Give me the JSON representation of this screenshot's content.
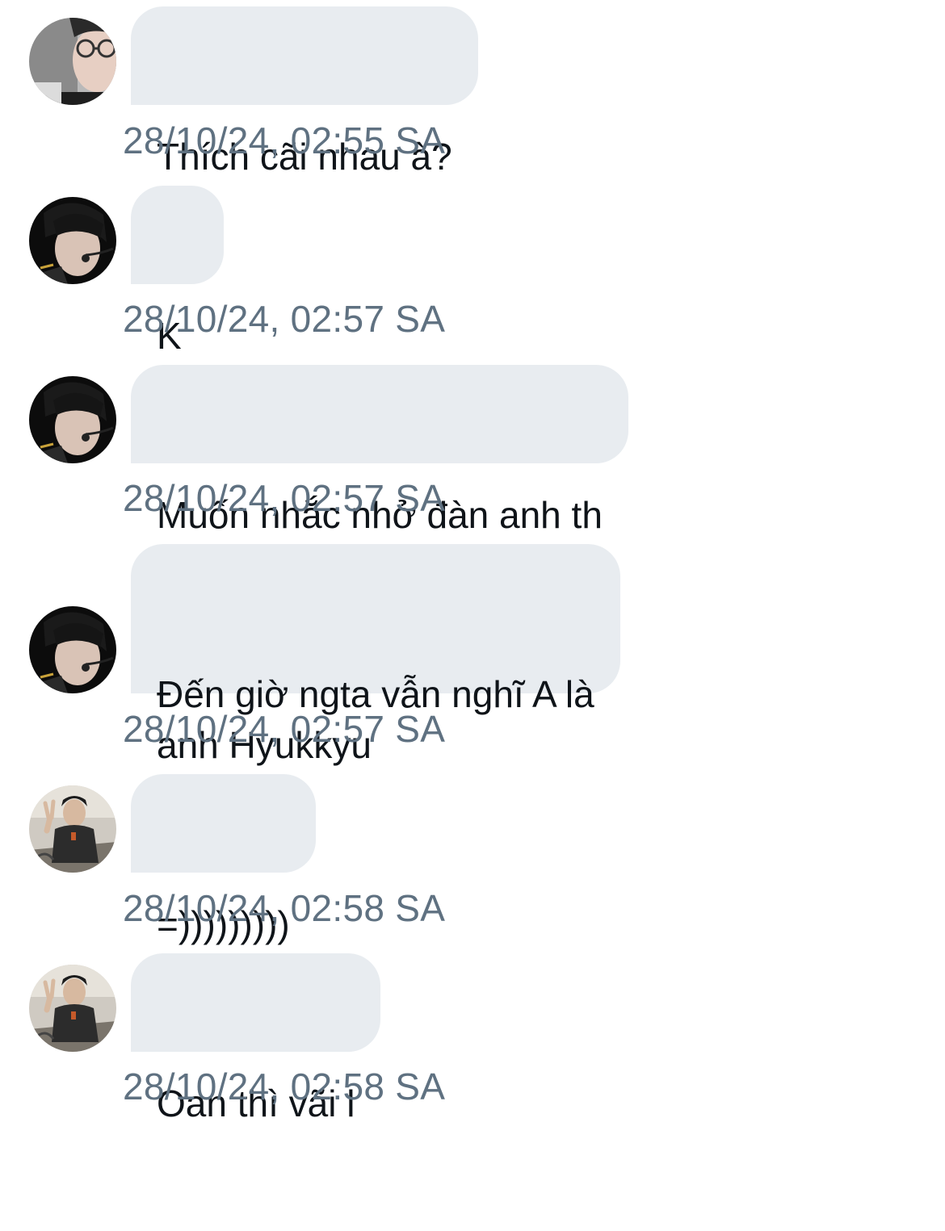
{
  "messages": [
    {
      "avatar": "avatar-glasses",
      "text": "Thích cãi nhau à?",
      "time": "28/10/24, 02:55 SA"
    },
    {
      "avatar": "avatar-headset",
      "text": "K",
      "time": "28/10/24, 02:57 SA"
    },
    {
      "avatar": "avatar-headset",
      "text": "Muốn nhắc nhở đàn anh th",
      "time": "28/10/24, 02:57 SA"
    },
    {
      "avatar": "avatar-headset",
      "text": "Đến giờ ngta vẫn nghĩ A là\nanh Hyukkyu",
      "time": "28/10/24, 02:57 SA"
    },
    {
      "avatar": "avatar-peace-sign",
      "text": "=)))))))))",
      "time": "28/10/24, 02:58 SA"
    },
    {
      "avatar": "avatar-peace-sign",
      "text": "Oan thì vãi l",
      "time": "28/10/24, 02:58 SA"
    }
  ],
  "colors": {
    "bubble_bg": "#e8ecf0",
    "message_text": "#0f1419",
    "timestamp_text": "#5f7181"
  }
}
